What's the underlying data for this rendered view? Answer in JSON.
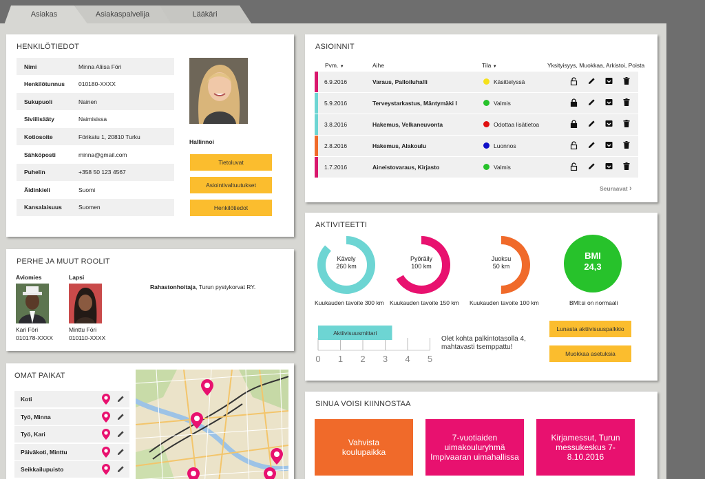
{
  "tabs": [
    {
      "label": "Asiakas"
    },
    {
      "label": "Asiakaspalvelija"
    },
    {
      "label": "Lääkäri"
    }
  ],
  "colors": {
    "yellow": "#fbbd2e",
    "magenta": "#e8116f",
    "teal": "#6dd5d3",
    "orange": "#f06a2a",
    "green": "#27c22b"
  },
  "henkilotiedot": {
    "title": "HENKILÖTIEDOT",
    "rows": [
      {
        "label": "Nimi",
        "value": "Minna Aliisa Föri"
      },
      {
        "label": "Henkilötunnus",
        "value": "010180-XXXX"
      },
      {
        "label": "Sukupuoli",
        "value": "Nainen"
      },
      {
        "label": "Siviilisääty",
        "value": "Naimisissa"
      },
      {
        "label": "Kotiosoite",
        "value": "Förikatu 1, 20810 Turku"
      },
      {
        "label": "Sähköposti",
        "value": "minna@gmail.com"
      },
      {
        "label": "Puhelin",
        "value": "+358 50 123 4567"
      },
      {
        "label": "Äidinkieli",
        "value": "Suomi"
      },
      {
        "label": "Kansalaisuus",
        "value": "Suomen"
      }
    ],
    "hallinnoi_label": "Hallinnoi",
    "buttons": [
      "Tietoluvat",
      "Asiointivaltuutukset",
      "Henkilötiedot"
    ]
  },
  "perhe": {
    "title": "PERHE JA MUUT ROOLIT",
    "spouse_heading": "Aviomies",
    "spouse_name": "Kari Föri",
    "spouse_id": "010178-XXXX",
    "child_heading": "Lapsi",
    "child_name": "Minttu Föri",
    "child_id": "010110-XXXX",
    "role_title": "Rahastonhoitaja",
    "role_rest": ", Turun pystykorvat RY."
  },
  "paikat": {
    "title": "OMAT PAIKAT",
    "items": [
      "Koti",
      "Työ, Minna",
      "Työ, Kari",
      "Päiväkoti, Minttu",
      "Seikkailupuisto"
    ]
  },
  "asioinnit": {
    "title": "ASIOINNIT",
    "col_date": "Pvm.",
    "col_subject": "Aihe",
    "col_status": "Tila",
    "col_actions": "Yksityisyys, Muokkaa, Arkistoi, Poista",
    "rows": [
      {
        "date": "6.9.2016",
        "subject": "Varaus, Palloiluhalli",
        "status": "Käsittelyssä",
        "bar": "#d9176d",
        "dot": "#f5e11b",
        "lock": "open"
      },
      {
        "date": "5.9.2016",
        "subject": "Terveystarkastus, Mäntymäki I",
        "status": "Valmis",
        "bar": "#6dd5d3",
        "dot": "#27c22b",
        "lock": "closed"
      },
      {
        "date": "3.8.2016",
        "subject": "Hakemus, Velkaneuvonta",
        "status": "Odottaa lisätietoa",
        "bar": "#6dd5d3",
        "dot": "#e01010",
        "lock": "closed"
      },
      {
        "date": "2.8.2016",
        "subject": "Hakemus, Alakoulu",
        "status": "Luonnos",
        "bar": "#f06a2a",
        "dot": "#1010c8",
        "lock": "open"
      },
      {
        "date": "1.7.2016",
        "subject": "Aineistovaraus, Kirjasto",
        "status": "Valmis",
        "bar": "#d9176d",
        "dot": "#27c22b",
        "lock": "open"
      }
    ],
    "next_label": "Seuraavat"
  },
  "aktiviteetti": {
    "title": "AKTIVITEETTI",
    "rings": [
      {
        "label": "Kävely",
        "value": "260 km",
        "goal": "Kuukauden tavoite 300 km",
        "progress": 0.867,
        "color": "#6dd5d3"
      },
      {
        "label": "Pyöräily",
        "value": "100 km",
        "goal": "Kuukauden tavoite 150 km",
        "progress": 0.667,
        "color": "#e8116f"
      },
      {
        "label": "Juoksu",
        "value": "50 km",
        "goal": "Kuukauden tavoite 100 km",
        "progress": 0.5,
        "color": "#f06a2a"
      }
    ],
    "bmi_label": "BMI",
    "bmi_value": "24,3",
    "bmi_note": "BMI:si on normaali",
    "meter_label": "Aktiivisuusmittari",
    "meter_ticks": [
      "0",
      "1",
      "2",
      "3",
      "4",
      "5"
    ],
    "meter_level": 3,
    "reward_text": "Olet kohta palkintotasolla 4, mahtavasti tsemppattu!",
    "btn_reward": "Lunasta aktiivisuuspalkkio",
    "btn_settings": "Muokkaa asetuksia"
  },
  "kiinnostaa": {
    "title": "SINUA VOISI KIINNOSTAA",
    "boxes": [
      {
        "text": "Vahvista koulupaikka",
        "color": "#f06a2a"
      },
      {
        "text": "7-vuotiaiden uimakouluryhmä Impivaaran uimahallissa",
        "color": "#e8116f"
      },
      {
        "text": "Kirjamessut, Turun messukeskus 7-8.10.2016",
        "color": "#e8116f"
      }
    ]
  }
}
